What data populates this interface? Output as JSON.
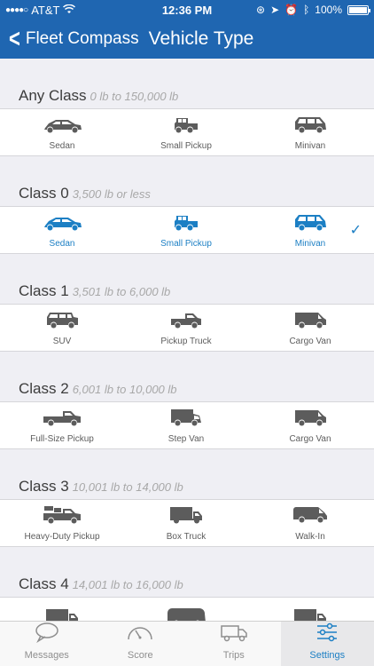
{
  "status_bar": {
    "signal": "●●●●○",
    "carrier": "AT&T",
    "time": "12:36 PM",
    "battery": "100%"
  },
  "nav": {
    "back_label": "Fleet Compass",
    "title": "Vehicle Type"
  },
  "sections": [
    {
      "name": "Any Class",
      "range": "0 lb to 150,000 lb",
      "selected": false,
      "vehicles": [
        {
          "label": "Sedan",
          "icon": "sedan-icon"
        },
        {
          "label": "Small Pickup",
          "icon": "small-pickup-icon"
        },
        {
          "label": "Minivan",
          "icon": "minivan-icon"
        }
      ]
    },
    {
      "name": "Class 0",
      "range": "3,500 lb or less",
      "selected": true,
      "vehicles": [
        {
          "label": "Sedan",
          "icon": "sedan-icon"
        },
        {
          "label": "Small Pickup",
          "icon": "small-pickup-icon"
        },
        {
          "label": "Minivan",
          "icon": "minivan-icon"
        }
      ]
    },
    {
      "name": "Class 1",
      "range": "3,501 lb to 6,000 lb",
      "selected": false,
      "vehicles": [
        {
          "label": "SUV",
          "icon": "suv-icon"
        },
        {
          "label": "Pickup Truck",
          "icon": "pickup-truck-icon"
        },
        {
          "label": "Cargo Van",
          "icon": "cargo-van-icon"
        }
      ]
    },
    {
      "name": "Class 2",
      "range": "6,001 lb to 10,000 lb",
      "selected": false,
      "vehicles": [
        {
          "label": "Full-Size Pickup",
          "icon": "full-size-pickup-icon"
        },
        {
          "label": "Step Van",
          "icon": "step-van-icon"
        },
        {
          "label": "Cargo Van",
          "icon": "cargo-van-icon"
        }
      ]
    },
    {
      "name": "Class 3",
      "range": "10,001 lb to 14,000 lb",
      "selected": false,
      "vehicles": [
        {
          "label": "Heavy-Duty Pickup",
          "icon": "heavy-duty-pickup-icon"
        },
        {
          "label": "Box Truck",
          "icon": "box-truck-icon"
        },
        {
          "label": "Walk-In",
          "icon": "walk-in-icon"
        }
      ]
    },
    {
      "name": "Class 4",
      "range": "14,001 lb to 16,000 lb",
      "selected": false,
      "vehicles": [
        {
          "label": "",
          "icon": "box-truck-icon"
        },
        {
          "label": "",
          "icon": "large-van-icon"
        },
        {
          "label": "",
          "icon": "box-truck-icon"
        }
      ]
    }
  ],
  "tabs": [
    {
      "label": "Messages",
      "icon": "speech-bubble-icon",
      "active": false
    },
    {
      "label": "Score",
      "icon": "gauge-icon",
      "active": false
    },
    {
      "label": "Trips",
      "icon": "truck-icon",
      "active": false
    },
    {
      "label": "Settings",
      "icon": "sliders-icon",
      "active": true
    }
  ],
  "colors": {
    "brand": "#1f66b1",
    "accent": "#1c7fc4",
    "icon_gray": "#5c5c5c"
  }
}
